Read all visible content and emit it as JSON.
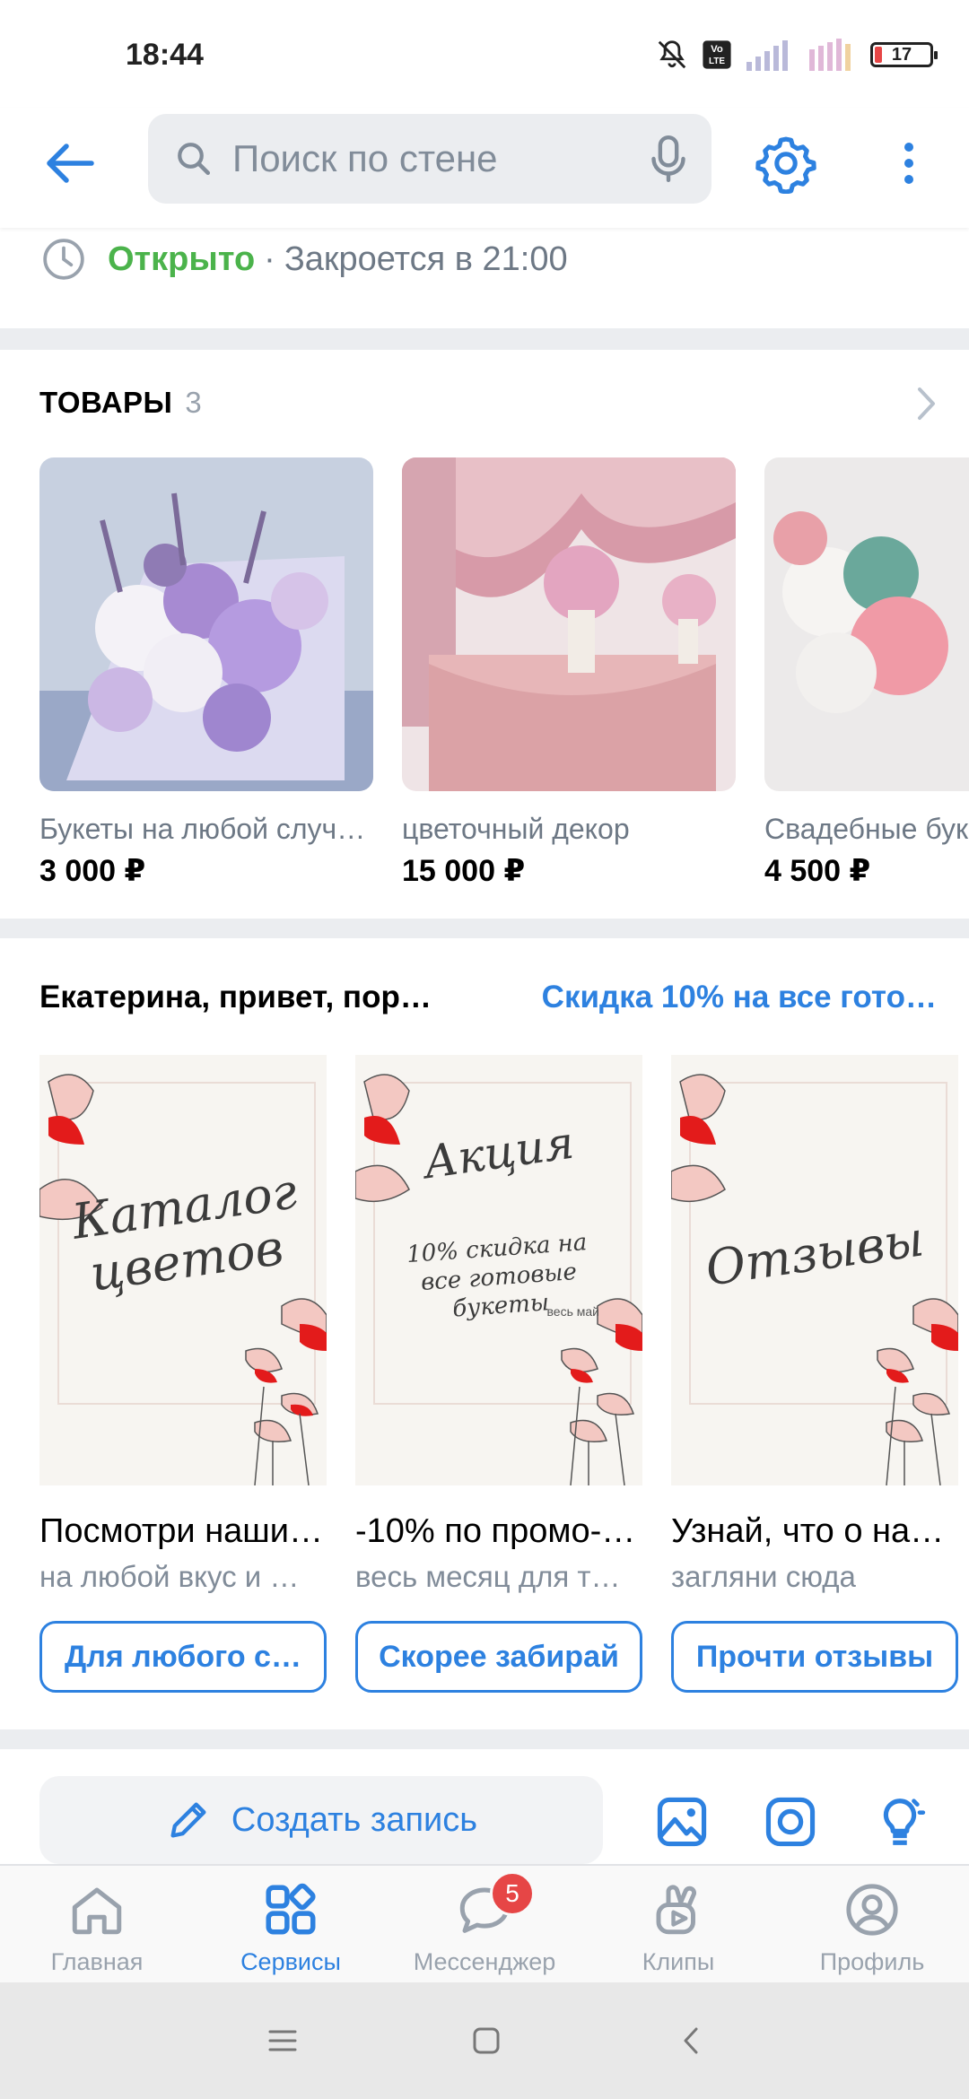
{
  "status_bar": {
    "time": "18:44",
    "battery": "17"
  },
  "search": {
    "placeholder": "Поиск по стене"
  },
  "hours": {
    "open": "Открыто",
    "separator": "·",
    "closes": "Закроется в 21:00"
  },
  "goods": {
    "title": "ТОВАРЫ",
    "count": "3",
    "items": [
      {
        "title": "Букеты на любой случ…",
        "price": "3 000 ₽"
      },
      {
        "title": "цветочный декор",
        "price": "15 000 ₽"
      },
      {
        "title": "Свадебные буке",
        "price": "4 500 ₽"
      }
    ]
  },
  "promo": {
    "tab_active": "Екатерина, привет, пор…",
    "tab_second": "Скидка 10% на все гото…",
    "items": [
      {
        "image_text": "Каталог цветов",
        "image_sub": "",
        "image_small": "",
        "title": "Посмотри наши…",
        "subtitle": "на любой вкус и …",
        "button": "Для любого с…"
      },
      {
        "image_text": "Акция",
        "image_sub": "10% скидка на все готовые букеты",
        "image_small": "весь май",
        "title": "-10% по промо-…",
        "subtitle": "весь месяц для т…",
        "button": "Скорее забирай"
      },
      {
        "image_text": "Отзывы",
        "image_sub": "",
        "image_small": "",
        "title": "Узнай, что о нас…",
        "subtitle": "загляни сюда",
        "button": "Прочти отзывы"
      }
    ]
  },
  "composer": {
    "create_label": "Создать запись"
  },
  "tabbar": {
    "items": [
      {
        "label": "Главная",
        "active": false
      },
      {
        "label": "Сервисы",
        "active": true
      },
      {
        "label": "Мессенджер",
        "active": false,
        "badge": "5"
      },
      {
        "label": "Клипы",
        "active": false
      },
      {
        "label": "Профиль",
        "active": false
      }
    ]
  },
  "colors": {
    "accent": "#2d81e0",
    "open_green": "#4bb34b",
    "badge_red": "#e64646",
    "secondary_text": "#818c99"
  }
}
